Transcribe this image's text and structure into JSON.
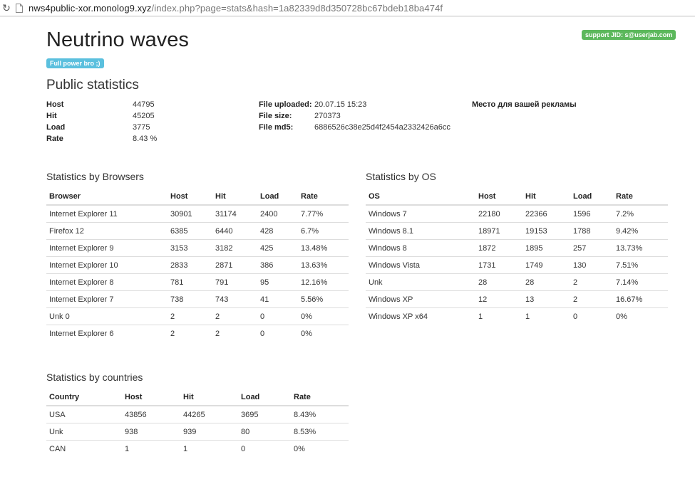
{
  "browser": {
    "url_host": "nws4public-xor.monolog9.xyz",
    "url_path": "/index.php?page=stats&hash=1a82339d8d350728bc67bdeb18ba474f"
  },
  "header": {
    "title": "Neutrino waves",
    "badge": "Full power bro ;)",
    "support": "support JID: s@userjab.com"
  },
  "public_stats": {
    "title": "Public statistics",
    "summary": [
      {
        "label": "Host",
        "value": "44795"
      },
      {
        "label": "Hit",
        "value": "45205"
      },
      {
        "label": "Load",
        "value": "3775"
      },
      {
        "label": "Rate",
        "value": "8.43 %"
      }
    ],
    "file": [
      {
        "label": "File uploaded:",
        "value": "20.07.15 15:23"
      },
      {
        "label": "File size:",
        "value": "270373"
      },
      {
        "label": "File md5:",
        "value": "6886526c38e25d4f2454a2332426a6cc"
      }
    ],
    "ad_text": "Место для вашей рекламы"
  },
  "browsers": {
    "title": "Statistics by Browsers",
    "columns": [
      "Browser",
      "Host",
      "Hit",
      "Load",
      "Rate"
    ],
    "rows": [
      [
        "Internet Explorer 11",
        "30901",
        "31174",
        "2400",
        "7.77%"
      ],
      [
        "Firefox 12",
        "6385",
        "6440",
        "428",
        "6.7%"
      ],
      [
        "Internet Explorer 9",
        "3153",
        "3182",
        "425",
        "13.48%"
      ],
      [
        "Internet Explorer 10",
        "2833",
        "2871",
        "386",
        "13.63%"
      ],
      [
        "Internet Explorer 8",
        "781",
        "791",
        "95",
        "12.16%"
      ],
      [
        "Internet Explorer 7",
        "738",
        "743",
        "41",
        "5.56%"
      ],
      [
        "Unk 0",
        "2",
        "2",
        "0",
        "0%"
      ],
      [
        "Internet Explorer 6",
        "2",
        "2",
        "0",
        "0%"
      ]
    ]
  },
  "os": {
    "title": "Statistics by OS",
    "columns": [
      "OS",
      "Host",
      "Hit",
      "Load",
      "Rate"
    ],
    "rows": [
      [
        "Windows 7",
        "22180",
        "22366",
        "1596",
        "7.2%"
      ],
      [
        "Windows 8.1",
        "18971",
        "19153",
        "1788",
        "9.42%"
      ],
      [
        "Windows 8",
        "1872",
        "1895",
        "257",
        "13.73%"
      ],
      [
        "Windows Vista",
        "1731",
        "1749",
        "130",
        "7.51%"
      ],
      [
        "Unk",
        "28",
        "28",
        "2",
        "7.14%"
      ],
      [
        "Windows XP",
        "12",
        "13",
        "2",
        "16.67%"
      ],
      [
        "Windows XP x64",
        "1",
        "1",
        "0",
        "0%"
      ]
    ]
  },
  "countries": {
    "title": "Statistics by countries",
    "columns": [
      "Country",
      "Host",
      "Hit",
      "Load",
      "Rate"
    ],
    "rows": [
      [
        "USA",
        "43856",
        "44265",
        "3695",
        "8.43%"
      ],
      [
        "Unk",
        "938",
        "939",
        "80",
        "8.53%"
      ],
      [
        "CAN",
        "1",
        "1",
        "0",
        "0%"
      ]
    ]
  },
  "colors": {
    "badge_info": "#5bc0de",
    "badge_success": "#5cb85c",
    "table_border": "#dddddd"
  }
}
